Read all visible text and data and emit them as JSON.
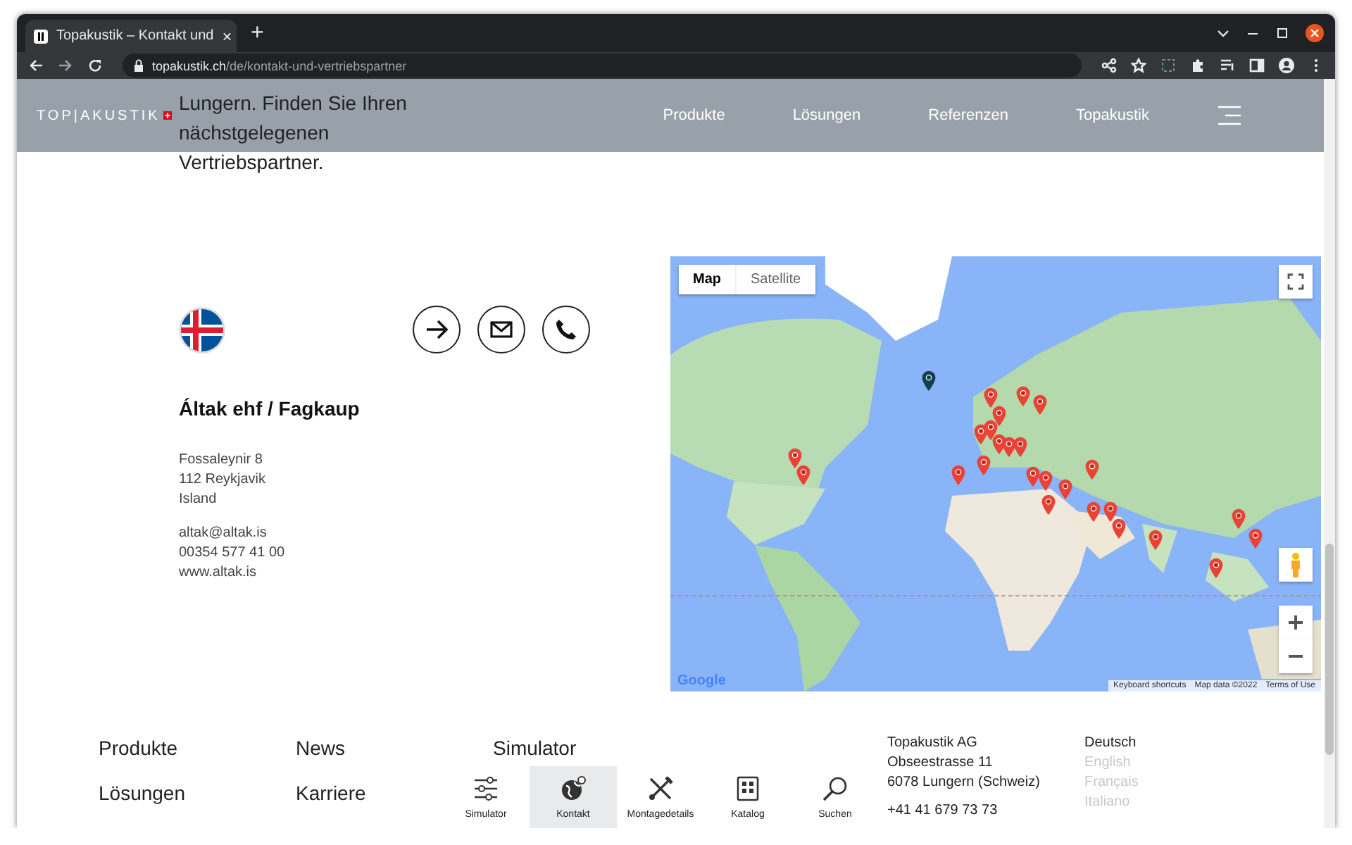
{
  "browser": {
    "tab": {
      "title": "Topakustik – Kontakt und",
      "close": "×"
    },
    "new_tab": "+",
    "url": {
      "host": "topakustik.ch",
      "path": "/de/kontakt-und-vertriebspartner"
    }
  },
  "header": {
    "logo": "TOP|AKUSTIK",
    "nav": [
      "Produkte",
      "Lösungen",
      "Referenzen",
      "Topakustik"
    ]
  },
  "intro": "Lungern. Finden Sie Ihren nächstgelegenen Vertriebspartner.",
  "partner": {
    "name": "Áltak ehf / Fagkaup",
    "address": [
      "Fossaleynir 8",
      "112 Reykjavik",
      "Island"
    ],
    "contact": [
      "altak@altak.is",
      "00354 577 41 00",
      "www.altak.is"
    ]
  },
  "map": {
    "types": [
      {
        "label": "Map",
        "selected": true
      },
      {
        "label": "Satellite",
        "selected": false
      }
    ],
    "markers": [
      {
        "selected": true
      },
      {
        "selected": false
      },
      {
        "selected": false
      },
      {
        "selected": false
      },
      {
        "selected": false
      },
      {
        "selected": false
      },
      {
        "selected": false
      },
      {
        "selected": false
      },
      {
        "selected": false
      },
      {
        "selected": false
      },
      {
        "selected": false
      },
      {
        "selected": false
      },
      {
        "selected": false
      },
      {
        "selected": false
      },
      {
        "selected": false
      },
      {
        "selected": false
      },
      {
        "selected": false
      },
      {
        "selected": false
      },
      {
        "selected": false
      },
      {
        "selected": false
      },
      {
        "selected": false
      },
      {
        "selected": false
      },
      {
        "selected": false
      },
      {
        "selected": false
      },
      {
        "selected": false
      },
      {
        "selected": false
      }
    ],
    "logo": "Google",
    "attribution": [
      "Keyboard shortcuts",
      "Map data ©2022",
      "Terms of Use"
    ]
  },
  "footer": {
    "links": [
      "Produkte",
      "News",
      "Simulator",
      "Lösungen",
      "Karriere"
    ],
    "company": [
      "Topakustik AG",
      "Obseestrasse 11",
      "6078 Lungern (Schweiz)",
      "+41 41 679 73 73"
    ],
    "languages": [
      {
        "label": "Deutsch",
        "selected": true
      },
      {
        "label": "English",
        "selected": false
      },
      {
        "label": "Français",
        "selected": false
      },
      {
        "label": "Italiano",
        "selected": false
      }
    ]
  },
  "dock": [
    {
      "label": "Simulator",
      "kind": "sliders",
      "selected": false
    },
    {
      "label": "Kontakt",
      "kind": "globe",
      "selected": true
    },
    {
      "label": "Montagedetails",
      "kind": "tools",
      "selected": false
    },
    {
      "label": "Katalog",
      "kind": "catalog",
      "selected": false
    },
    {
      "label": "Suchen",
      "kind": "search",
      "selected": false
    }
  ]
}
